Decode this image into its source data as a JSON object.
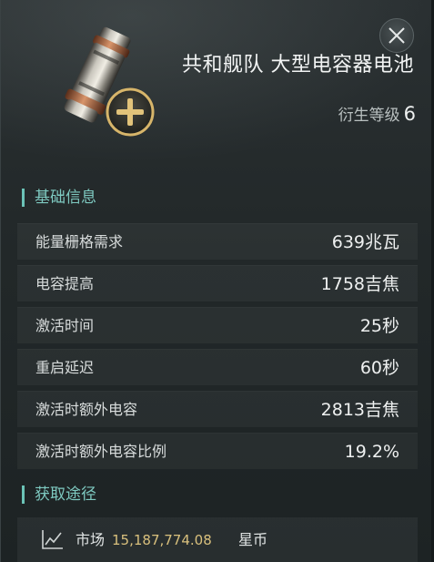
{
  "item": {
    "name": "共和舰队 大型电容器电池",
    "tech_level_label": "衍生等级",
    "tech_level_value": "6"
  },
  "sections": {
    "attributes_title": "基础信息",
    "acquire_title": "获取途径"
  },
  "attributes": [
    {
      "label": "能量栅格需求",
      "value": "639兆瓦"
    },
    {
      "label": "电容提高",
      "value": "1758吉焦"
    },
    {
      "label": "激活时间",
      "value": "25秒"
    },
    {
      "label": "重启延迟",
      "value": "60秒"
    },
    {
      "label": "激活时额外电容",
      "value": "2813吉焦"
    },
    {
      "label": "激活时额外电容比例",
      "value": "19.2%"
    }
  ],
  "market": {
    "label": "市场",
    "price": "15,187,774.08",
    "currency": "星币"
  },
  "icons": {
    "close": "close-icon",
    "add": "plus-icon",
    "market": "chart-line-icon"
  },
  "colors": {
    "accent": "#6bc3b7",
    "price": "#d9c07d",
    "background": "#222829"
  }
}
